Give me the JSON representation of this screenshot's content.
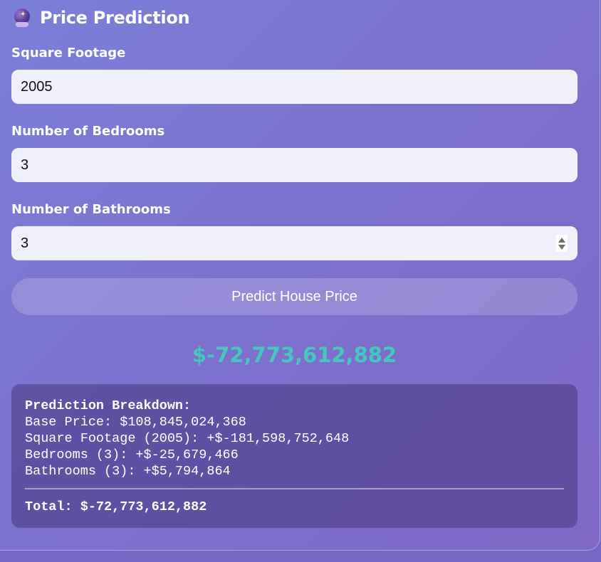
{
  "header": {
    "icon": "crystal-ball-icon",
    "title": "Price Prediction"
  },
  "form": {
    "square_footage": {
      "label": "Square Footage",
      "value": "2005"
    },
    "bedrooms": {
      "label": "Number of Bedrooms",
      "value": "3"
    },
    "bathrooms": {
      "label": "Number of Bathrooms",
      "value": "3"
    },
    "submit_label": "Predict House Price"
  },
  "result": {
    "price": "$-72,773,612,882",
    "color": "#46c7c0"
  },
  "breakdown": {
    "heading": "Prediction Breakdown:",
    "lines": [
      "Base Price: $108,845,024,368",
      "Square Footage (2005): +$-181,598,752,648",
      "Bedrooms (3): +$-25,679,466",
      "Bathrooms (3): +$5,794,864"
    ],
    "total": "Total: $-72,773,612,882"
  }
}
